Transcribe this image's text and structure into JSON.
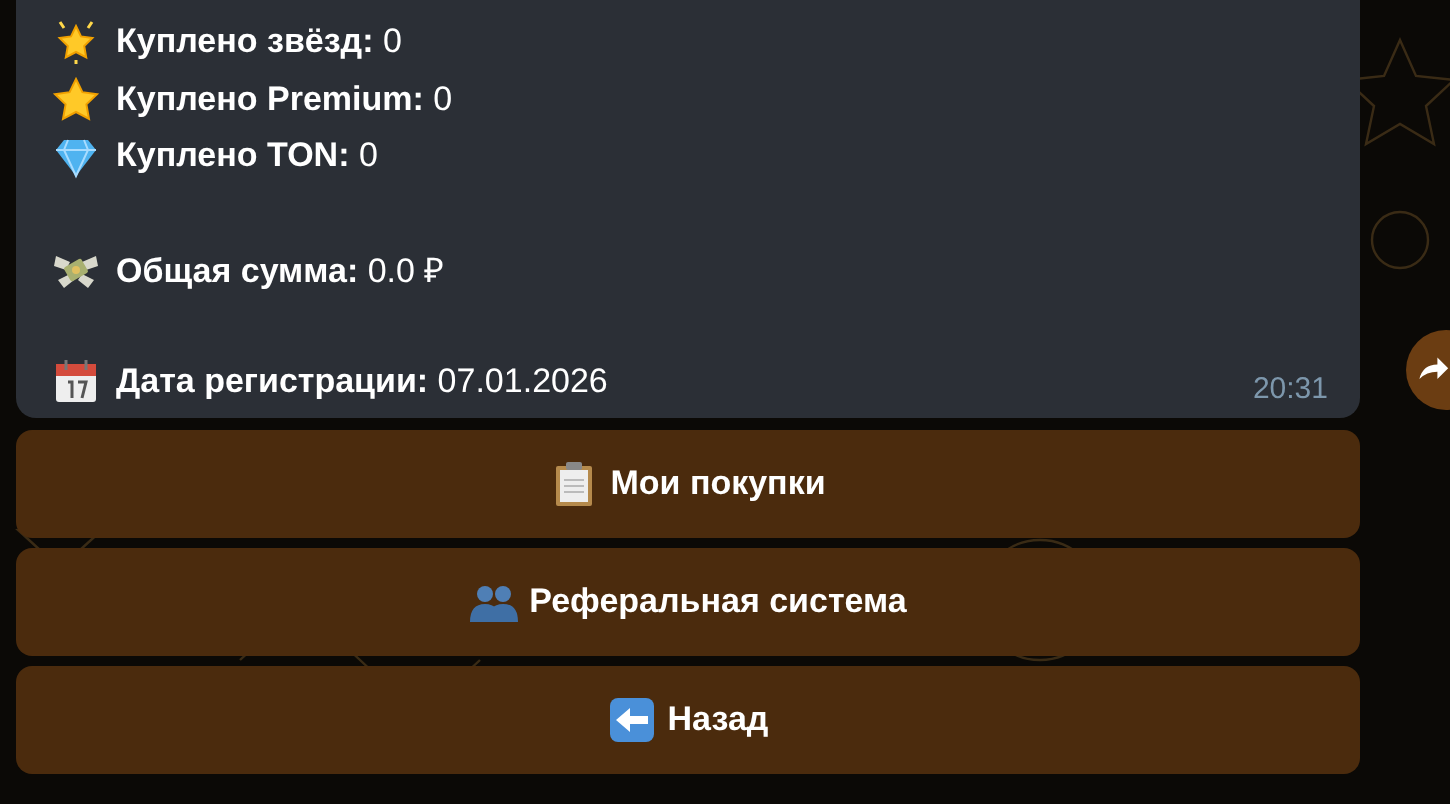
{
  "message": {
    "paragraphs": [
      [
        {
          "kind": "glowing-star",
          "text": "**Куплено звёзд:** 0"
        },
        {
          "kind": "star",
          "text": "**Куплено Premium:** 0"
        },
        {
          "kind": "gem",
          "text": "**Куплено TON:** 0"
        }
      ],
      [
        {
          "kind": "money",
          "text": "**Общая сумма:** 0.0 ₽"
        }
      ],
      [
        {
          "kind": "calendar",
          "text": "**Дата регистрации:** 07.01.2026"
        }
      ]
    ],
    "time": "20:31"
  },
  "buttons": [
    {
      "kind": "clipboard",
      "label": "Мои покупки"
    },
    {
      "kind": "people",
      "label": "Реферальная система"
    },
    {
      "kind": "back",
      "label": "Назад"
    }
  ]
}
